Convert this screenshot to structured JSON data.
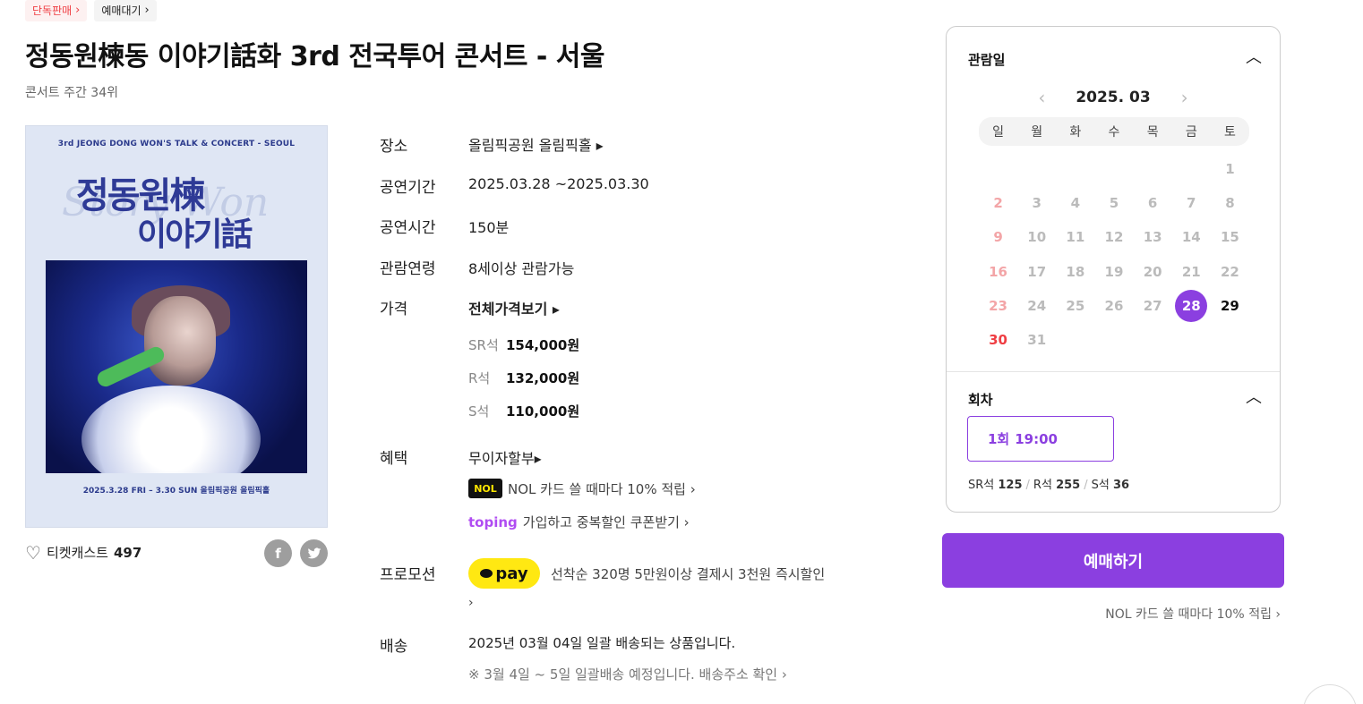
{
  "badges": [
    {
      "label": "단독판매",
      "chevron": "›"
    },
    {
      "label": "예매대기",
      "chevron": "›"
    }
  ],
  "title": "정동원楝동 이야기話화 3rd 전국투어 콘서트 - 서울",
  "rank": "콘서트 주간 34위",
  "poster": {
    "tagline": "3rd JEONG DONG WON'S TALK & CONCERT - SEOUL",
    "logo_line1": "정동원楝",
    "logo_line2": "이야기話",
    "dates": "2025.3.28 FRI – 3.30 SUN 올림픽공원 올림픽홀"
  },
  "ticketcast": {
    "label": "티켓캐스트",
    "count": "497"
  },
  "share": {
    "facebook": "f",
    "twitter": "t"
  },
  "info": {
    "venue_label": "장소",
    "venue_value": "올림픽공원 올림픽홀 ▸",
    "period_label": "공연기간",
    "period_value": "2025.03.28 ~2025.03.30",
    "runtime_label": "공연시간",
    "runtime_value": "150분",
    "age_label": "관람연령",
    "age_value": "8세이상 관람가능",
    "price_label": "가격",
    "price_link": "전체가격보기 ▸",
    "prices": [
      {
        "grade": "SR석",
        "amount": "154,000원"
      },
      {
        "grade": "R석",
        "amount": "132,000원"
      },
      {
        "grade": "S석",
        "amount": "110,000원"
      }
    ],
    "benefit_label": "혜택",
    "benefit_value": "무이자할부▸",
    "benefit_nol_logo": "NOL",
    "benefit_nol": "NOL 카드 쓸 때마다 10% 적립 ›",
    "benefit_toping_logo": "toping",
    "benefit_toping": "가입하고 중복할인 쿠폰받기 ›",
    "promo_label": "프로모션",
    "promo_logo": "pay",
    "promo_text": "선착순 320명 5만원이상 결제시 3천원 즉시할인",
    "promo_more": "›",
    "delivery_label": "배송",
    "delivery_value": "2025년 03월 04일 일괄 배송되는 상품입니다.",
    "delivery_note": "※ 3월 4일 ~ 5일 일괄배송 예정입니다. 배송주소 확인 ›"
  },
  "calendar": {
    "section_title": "관람일",
    "month": "2025. 03",
    "prev": "‹",
    "next": "›",
    "weekdays": [
      "일",
      "월",
      "화",
      "수",
      "목",
      "금",
      "토"
    ],
    "days": [
      "",
      "",
      "",
      "",
      "",
      "",
      "1",
      "2",
      "3",
      "4",
      "5",
      "6",
      "7",
      "8",
      "9",
      "10",
      "11",
      "12",
      "13",
      "14",
      "15",
      "16",
      "17",
      "18",
      "19",
      "20",
      "21",
      "22",
      "23",
      "24",
      "25",
      "26",
      "27",
      "28",
      "29",
      "30",
      "31"
    ],
    "available": [
      "28",
      "29",
      "30"
    ],
    "selected": "28"
  },
  "rounds": {
    "section_title": "회차",
    "round_label": "1회",
    "round_time": "19:00",
    "seats": [
      {
        "grade": "SR석",
        "count": "125"
      },
      {
        "grade": "R석",
        "count": "255"
      },
      {
        "grade": "S석",
        "count": "36"
      }
    ]
  },
  "book_button": "예매하기",
  "nol_promo": "NOL 카드 쓸 때마다 10% 적립 ›",
  "caret_up": "︿",
  "scroll_top": "︿",
  "colors": {
    "accent": "#8b3fe0",
    "sunday": "#ef3e43",
    "badge_red": "#ef3e43"
  }
}
